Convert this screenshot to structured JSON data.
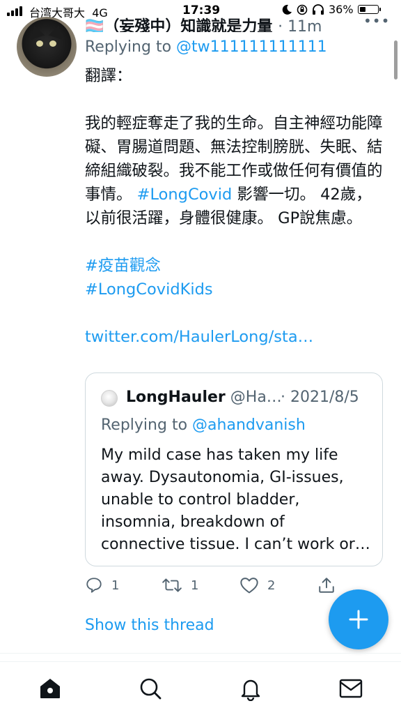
{
  "status_bar": {
    "carrier": "台湾大哥大",
    "network": "4G",
    "time": "17:39",
    "battery": "36%",
    "battery_level": 0.36
  },
  "tweet": {
    "author_partial": "🏳️‍⚧️（妄殘中）知識就是力量",
    "time_partial": "· 11m",
    "replying_prefix": "Replying to",
    "replying_handle": "@tw111111111111",
    "lines": [
      "翻譯：",
      "",
      "我的輕症奪走了我的生命。自主神經功能障礙、胃腸道問題、無法控制膀胱、失眠、結締組織破裂。我不能工作或做任何有價值的事情。 #LongCovid 影響一切。 42歲，以前很活躍，身體很健康。 GP說焦慮。",
      "",
      "#疫苗觀念",
      "#LongCovidKids",
      "",
      "twitter.com/HaulerLong/sta…"
    ],
    "body_main": "我的輕症奪走了我的生命。自主神經功能障礙、胃腸道問題、無法控制膀胱、失眠、結締組織破裂。我不能工作或做任何有價值的事情。 ",
    "hashtag_longcovid": "#LongCovid",
    "body_after": " 影響一切。 42歲，以前很活躍，身體很健康。 GP說焦慮。",
    "translation_label": "翻譯：",
    "hashtag_1": "#疫苗觀念",
    "hashtag_2": "#LongCovidKids",
    "link": "twitter.com/HaulerLong/sta…"
  },
  "quote": {
    "name": "LongHauler",
    "handle": "@Ha…",
    "date": "· 2021/8/5",
    "replying_prefix": "Replying to",
    "replying_handle": "@ahandvanish",
    "text": "My mild case has taken my life away. Dysautonomia, GI-issues, unable to control bladder, insomnia, breakdown of connective tissue. I can’t work or…"
  },
  "actions": {
    "reply_count": "1",
    "retweet_count": "1",
    "like_count": "2"
  },
  "show_thread": "Show this thread",
  "colors": {
    "accent": "#1d9bf0",
    "text": "#0f1419",
    "muted": "#536471",
    "border": "#cfd9de"
  },
  "icons": [
    "reply-icon",
    "retweet-icon",
    "like-icon",
    "share-icon",
    "compose-plus-icon",
    "home-icon",
    "search-icon",
    "notifications-bell-icon",
    "messages-envelope-icon"
  ]
}
